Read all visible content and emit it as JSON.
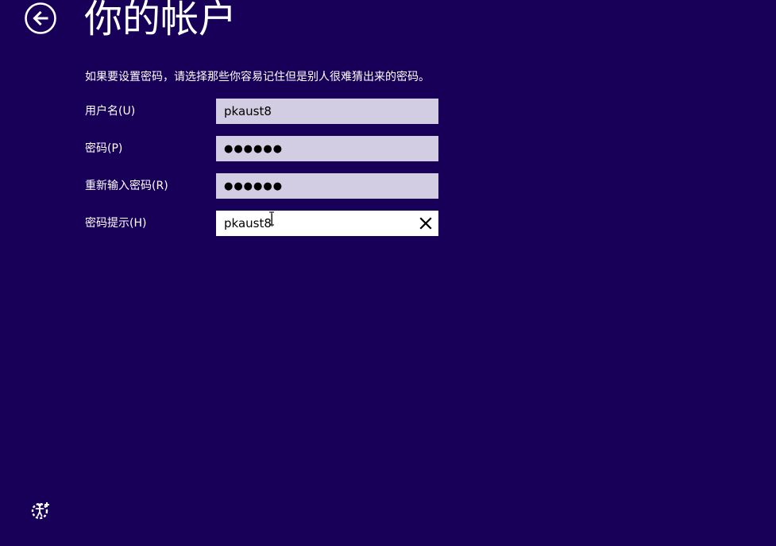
{
  "header": {
    "title": "你的帐户",
    "back_icon": "back-arrow-circle-icon"
  },
  "instruction": "如果要设置密码，请选择那些你容易记住但是别人很难猜出来的密码。",
  "form": {
    "username": {
      "label": "用户名(U)",
      "value": "pkaust8"
    },
    "password": {
      "label": "密码(P)",
      "value": "●●●●●●"
    },
    "confirm_password": {
      "label": "重新输入密码(R)",
      "value": "●●●●●●"
    },
    "password_hint": {
      "label": "密码提示(H)",
      "value": "pkaust8",
      "clear_icon": "close-icon"
    }
  },
  "footer": {
    "ease_of_access_icon": "ease-of-access-icon"
  },
  "colors": {
    "background": "#180059",
    "input_background": "#d3cde3",
    "input_focused_background": "#ffffff",
    "text": "#ffffff"
  }
}
